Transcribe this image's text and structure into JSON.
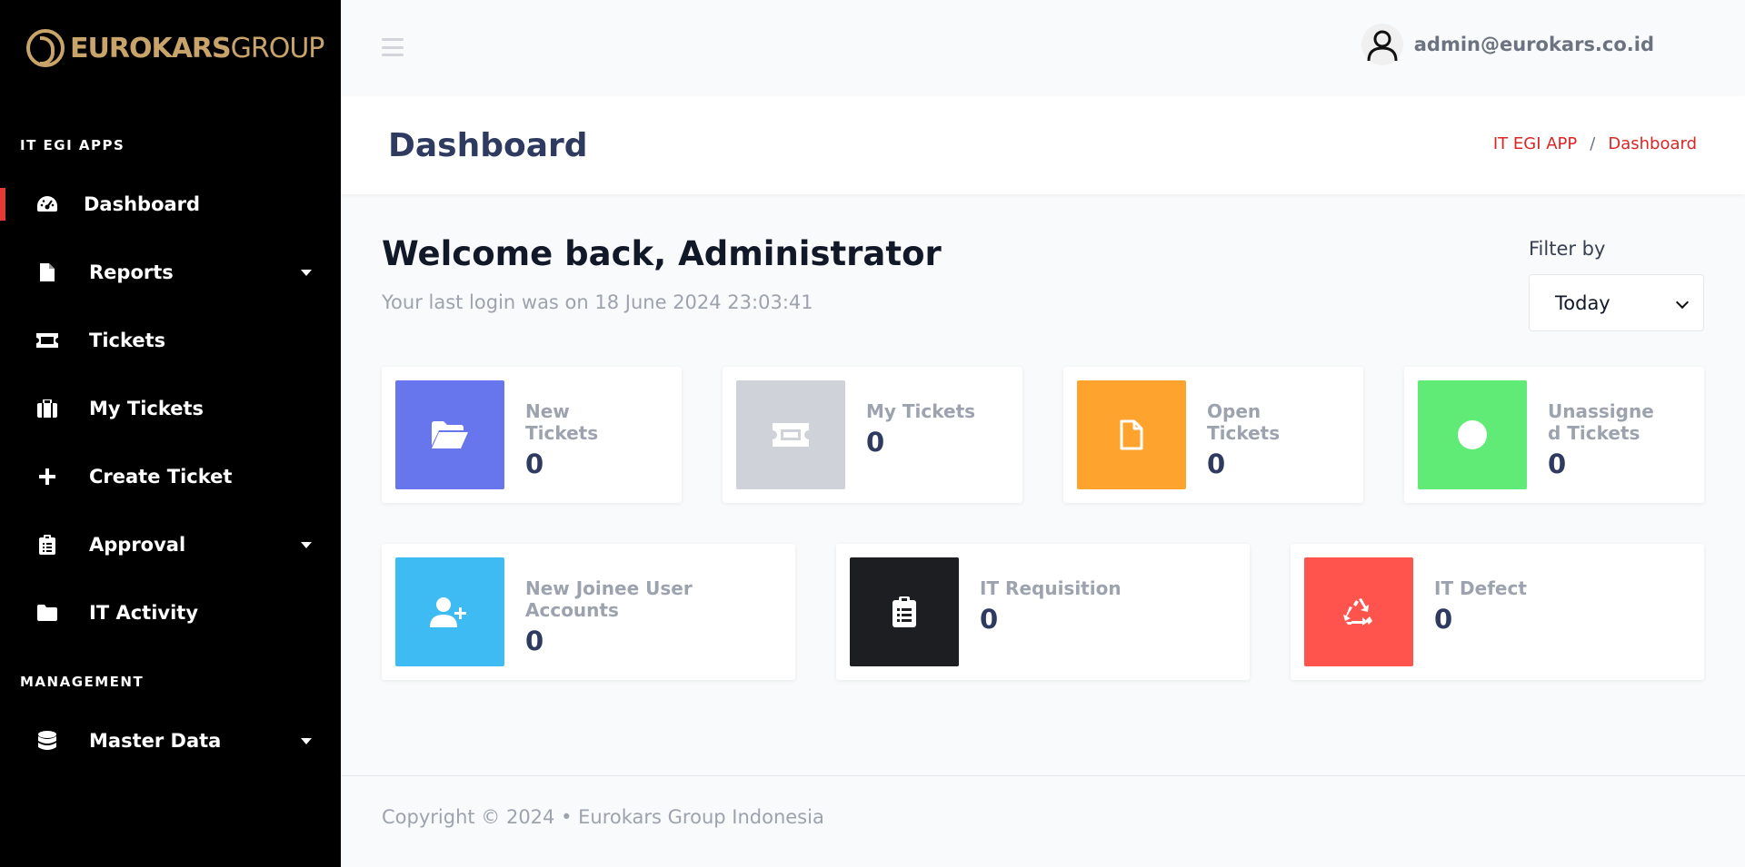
{
  "brand": {
    "name_bold": "EUROKARS",
    "name_light": "GROUP",
    "color": "#c9a46a"
  },
  "sidebar": {
    "section1": "IT EGI APPS",
    "section2": "MANAGEMENT",
    "items": [
      {
        "label": "Dashboard",
        "icon": "speedometer-icon",
        "active": true
      },
      {
        "label": "Reports",
        "icon": "file-icon",
        "has_submenu": true
      },
      {
        "label": "Tickets",
        "icon": "ticket-icon"
      },
      {
        "label": "My Tickets",
        "icon": "briefcase-icon"
      },
      {
        "label": "Create Ticket",
        "icon": "plus-icon"
      },
      {
        "label": "Approval",
        "icon": "clipboard-icon",
        "has_submenu": true
      },
      {
        "label": "IT Activity",
        "icon": "folder-icon"
      },
      {
        "label": "Master Data",
        "icon": "database-icon",
        "has_submenu": true
      }
    ],
    "active_color": "#e53935"
  },
  "topbar": {
    "user_email": "admin@eurokars.co.id"
  },
  "header": {
    "title": "Dashboard",
    "breadcrumb": [
      "IT EGI APP",
      "/",
      "Dashboard"
    ]
  },
  "welcome": {
    "heading": "Welcome back, Administrator",
    "last_login": "Your last login was on 18 June 2024 23:03:41"
  },
  "filter": {
    "label": "Filter by",
    "selected": "Today"
  },
  "cards_row1": [
    {
      "title": "New Tickets",
      "value": "0",
      "color": "#6776ec",
      "icon": "folder-open-icon"
    },
    {
      "title": "My Tickets",
      "value": "0",
      "color": "#cfd3d9",
      "icon": "ticket-icon"
    },
    {
      "title": "Open Tickets",
      "value": "0",
      "color": "#fda32e",
      "icon": "file-icon"
    },
    {
      "title": "Unassigned Tickets",
      "value": "0",
      "color": "#5feb75",
      "icon": "circle-icon"
    }
  ],
  "cards_row2": [
    {
      "title": "New Joinee User Accounts",
      "value": "0",
      "color": "#3ebbf2",
      "icon": "user-plus-icon"
    },
    {
      "title": "IT Requisition",
      "value": "0",
      "color": "#1c1e21",
      "icon": "clipboard-list-icon"
    },
    {
      "title": "IT Defect",
      "value": "0",
      "color": "#fe544d",
      "icon": "recycle-icon"
    }
  ],
  "footer": {
    "text": "Copyright © 2024  •  Eurokars Group Indonesia"
  }
}
